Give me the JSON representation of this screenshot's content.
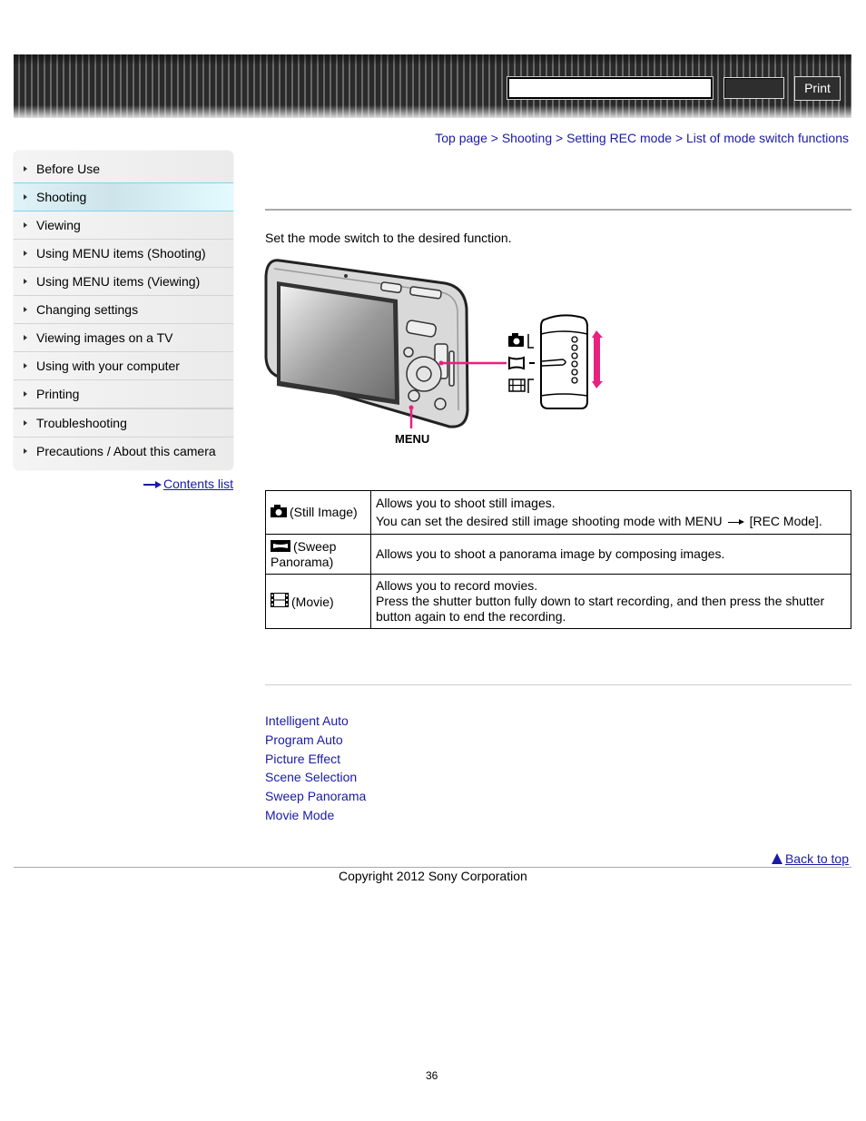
{
  "header": {
    "search_placeholder": "",
    "search_button_label": "",
    "print_label": "Print"
  },
  "breadcrumb": [
    {
      "label": "Top page"
    },
    {
      "label": "Shooting"
    },
    {
      "label": "Setting REC mode"
    },
    {
      "label": "List of mode switch functions"
    }
  ],
  "breadcrumb_separator": ">",
  "sidebar": {
    "items": [
      {
        "label": "Before Use"
      },
      {
        "label": "Shooting",
        "active": true
      },
      {
        "label": "Viewing"
      },
      {
        "label": "Using MENU items (Shooting)"
      },
      {
        "label": "Using MENU items (Viewing)"
      },
      {
        "label": "Changing settings"
      },
      {
        "label": "Viewing images on a TV"
      },
      {
        "label": "Using with your computer"
      },
      {
        "label": "Printing"
      },
      {
        "label": "Troubleshooting"
      },
      {
        "label": "Precautions / About this camera"
      }
    ],
    "contents_link": "Contents list"
  },
  "main": {
    "intro": "Set the mode switch to the desired function.",
    "figure": {
      "menu_label": "MENU",
      "accent_color": "#e8217f"
    },
    "table": {
      "rows": [
        {
          "icon": "still-image-icon",
          "mode": "(Still Image)",
          "lines": [
            "Allows you to shoot still images.",
            "You can set the desired still image shooting mode with MENU",
            "[REC Mode]."
          ]
        },
        {
          "icon": "sweep-panorama-icon",
          "mode": "(Sweep Panorama)",
          "lines": [
            "Allows you to shoot a panorama image by composing images."
          ]
        },
        {
          "icon": "movie-icon",
          "mode": "(Movie)",
          "lines": [
            "Allows you to record movies.",
            "Press the shutter button fully down to start recording, and then press the shutter button again to end the recording."
          ]
        }
      ]
    },
    "related_links": [
      {
        "label": "Intelligent Auto"
      },
      {
        "label": "Program Auto"
      },
      {
        "label": "Picture Effect"
      },
      {
        "label": "Scene Selection"
      },
      {
        "label": "Sweep Panorama"
      },
      {
        "label": "Movie Mode"
      }
    ]
  },
  "footer": {
    "back_to_top": "Back to top",
    "copyright": "Copyright 2012 Sony Corporation",
    "page_number": "36"
  },
  "colors": {
    "link": "#1a1aa6",
    "active_nav_border": "#7fd4ec",
    "header_dark": "#2a2a2a"
  }
}
